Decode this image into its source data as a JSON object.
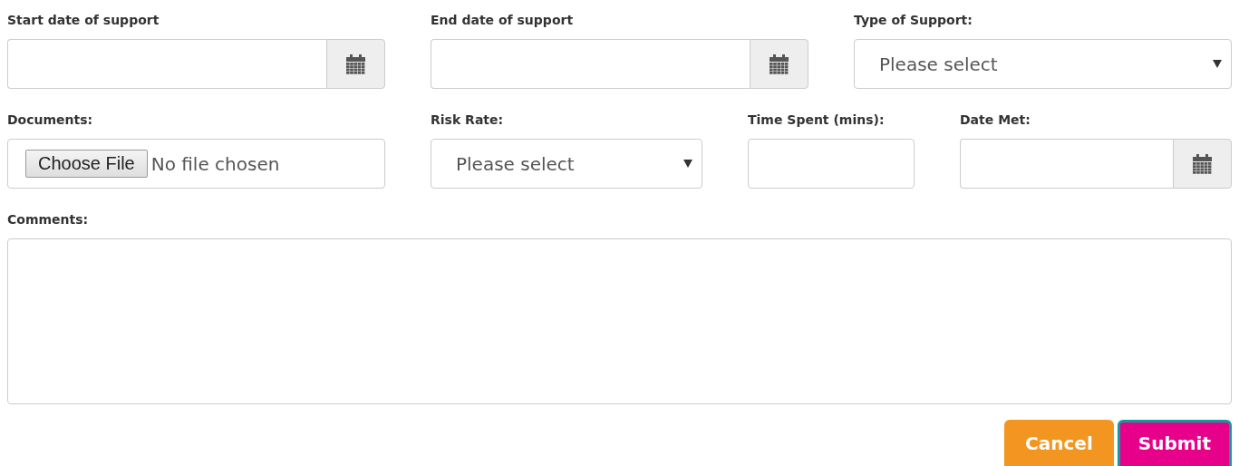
{
  "rows": [
    {
      "fields": [
        {
          "kind": "date",
          "label": "Start date of support"
        },
        {
          "kind": "date",
          "label": "End date of support"
        },
        {
          "kind": "select",
          "label": "Type of Support:",
          "value": "Please select"
        }
      ]
    },
    {
      "fields": [
        {
          "kind": "file",
          "label": "Documents:",
          "button": "Choose File",
          "status": "No file chosen"
        },
        {
          "kind": "select",
          "label": "Risk Rate:",
          "value": "Please select"
        },
        {
          "kind": "text",
          "label": "Time Spent (mins):"
        },
        {
          "kind": "date",
          "label": "Date Met:"
        }
      ]
    },
    {
      "fields": [
        {
          "kind": "textarea",
          "label": "Comments:"
        }
      ]
    }
  ],
  "buttons": [
    {
      "kind": "cancel",
      "label": "Cancel",
      "focused": false
    },
    {
      "kind": "submit",
      "label": "Submit",
      "focused": true
    }
  ]
}
